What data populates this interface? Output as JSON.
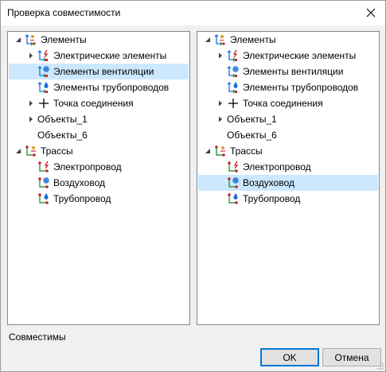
{
  "window": {
    "title": "Проверка совместимости"
  },
  "left_tree": {
    "items": [
      {
        "label": "Элементы",
        "expander": "expanded",
        "icon": "elements-icon",
        "level": 0
      },
      {
        "label": "Электрические элементы",
        "expander": "collapsed",
        "icon": "electrical-elements-icon",
        "level": 1
      },
      {
        "label": "Элементы вентиляции",
        "expander": "none",
        "icon": "ventilation-elements-icon",
        "level": 1,
        "selected": true
      },
      {
        "label": "Элементы трубопроводов",
        "expander": "none",
        "icon": "pipeline-elements-icon",
        "level": 1
      },
      {
        "label": "Точка соединения",
        "expander": "collapsed",
        "icon": "plus-icon",
        "level": 1
      },
      {
        "label": "Объекты_1",
        "expander": "collapsed",
        "icon": "",
        "level": 1
      },
      {
        "label": "Объекты_6",
        "expander": "none",
        "icon": "",
        "level": 1
      },
      {
        "label": "Трассы",
        "expander": "expanded",
        "icon": "routes-icon",
        "level": 0
      },
      {
        "label": "Электропровод",
        "expander": "none",
        "icon": "electric-wire-icon",
        "level": 1
      },
      {
        "label": "Воздуховод",
        "expander": "none",
        "icon": "air-duct-icon",
        "level": 1
      },
      {
        "label": "Трубопровод",
        "expander": "none",
        "icon": "pipeline-icon",
        "level": 1
      }
    ]
  },
  "right_tree": {
    "items": [
      {
        "label": "Элементы",
        "expander": "expanded",
        "icon": "elements-icon",
        "level": 0
      },
      {
        "label": "Электрические элементы",
        "expander": "collapsed",
        "icon": "electrical-elements-icon",
        "level": 1
      },
      {
        "label": "Элементы вентиляции",
        "expander": "none",
        "icon": "ventilation-elements-icon",
        "level": 1
      },
      {
        "label": "Элементы трубопроводов",
        "expander": "none",
        "icon": "pipeline-elements-icon",
        "level": 1
      },
      {
        "label": "Точка соединения",
        "expander": "collapsed",
        "icon": "plus-icon",
        "level": 1
      },
      {
        "label": "Объекты_1",
        "expander": "collapsed",
        "icon": "",
        "level": 1
      },
      {
        "label": "Объекты_6",
        "expander": "none",
        "icon": "",
        "level": 1
      },
      {
        "label": "Трассы",
        "expander": "expanded",
        "icon": "routes-icon",
        "level": 0
      },
      {
        "label": "Электропровод",
        "expander": "none",
        "icon": "electric-wire-icon",
        "level": 1
      },
      {
        "label": "Воздуховод",
        "expander": "none",
        "icon": "air-duct-icon",
        "level": 1,
        "selected": true
      },
      {
        "label": "Трубопровод",
        "expander": "none",
        "icon": "pipeline-icon",
        "level": 1
      }
    ]
  },
  "status": {
    "text": "Совместимы"
  },
  "buttons": {
    "ok_label": "OK",
    "cancel_label": "Отмена"
  },
  "colors": {
    "selection": "#cce8ff",
    "accent": "#0078d7",
    "route_red": "#d0202a",
    "route_green": "#2e9a3a",
    "route_blue": "#1e6fd9"
  }
}
